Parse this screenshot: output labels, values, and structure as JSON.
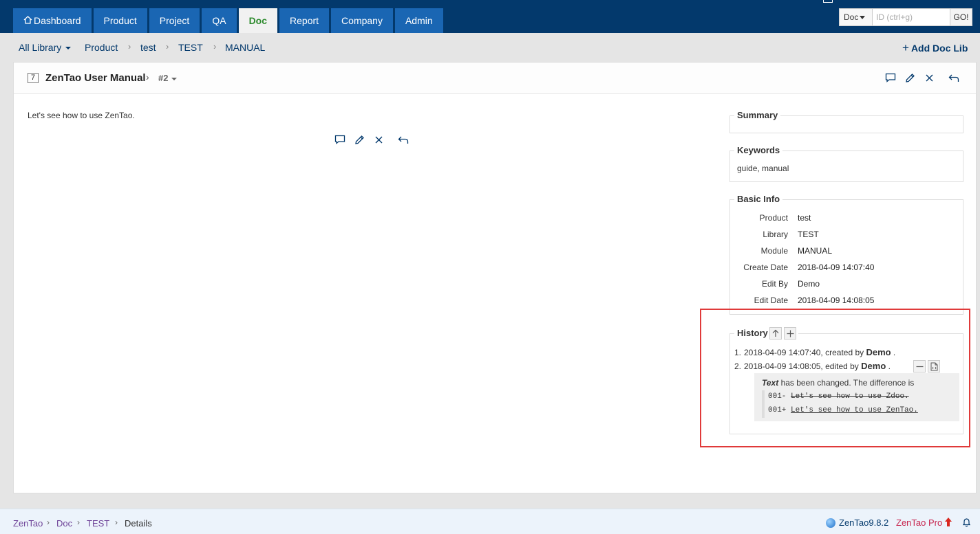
{
  "nav": {
    "tabs": [
      {
        "label": "Dashboard",
        "active": false
      },
      {
        "label": "Product",
        "active": false
      },
      {
        "label": "Project",
        "active": false
      },
      {
        "label": "QA",
        "active": false
      },
      {
        "label": "Doc",
        "active": true
      },
      {
        "label": "Report",
        "active": false
      },
      {
        "label": "Company",
        "active": false
      },
      {
        "label": "Admin",
        "active": false
      }
    ]
  },
  "search": {
    "type": "Doc",
    "placeholder": "ID (ctrl+g)",
    "go_label": "GO!"
  },
  "subnav": {
    "library": "All Library",
    "crumbs": [
      "Product",
      "test",
      "TEST",
      "MANUAL"
    ],
    "add_label": "Add Doc Lib"
  },
  "doc": {
    "id": "7",
    "title": "ZenTao User Manual",
    "version": "#2",
    "content": "Let's see how to use ZenTao."
  },
  "sidebar": {
    "summary_legend": "Summary",
    "keywords_legend": "Keywords",
    "keywords": "guide, manual",
    "basic_legend": "Basic Info",
    "basic": {
      "product_label": "Product",
      "product": "test",
      "library_label": "Library",
      "library": "TEST",
      "module_label": "Module",
      "module": "MANUAL",
      "create_date_label": "Create Date",
      "create_date": "2018-04-09 14:07:40",
      "edit_by_label": "Edit By",
      "edit_by": "Demo",
      "edit_date_label": "Edit Date",
      "edit_date": "2018-04-09 14:08:05"
    },
    "history_legend": "History",
    "history": [
      {
        "num": "1.",
        "text": "2018-04-09 14:07:40, created by ",
        "user": "Demo",
        "tail": " ."
      },
      {
        "num": "2.",
        "text": "2018-04-09 14:08:05, edited by ",
        "user": "Demo",
        "tail": " ."
      }
    ],
    "diff": {
      "field": "Text",
      "message": " has been changed. The difference is",
      "del_prefix": "001- ",
      "del_text": "Let's see how to use Zdoo.",
      "ins_prefix": "001+ ",
      "ins_text": "Let's see how to use ZenTao."
    }
  },
  "footer": {
    "crumbs": [
      "ZenTao",
      "Doc",
      "TEST",
      "Details"
    ],
    "version": "ZenTao9.8.2",
    "pro": "ZenTao Pro"
  },
  "colors": {
    "topbar": "#03396c",
    "tab": "#1a66b3",
    "active_tab_text": "#2e8b2e",
    "highlight": "#e03a3a"
  },
  "icons": [
    "home-icon",
    "comment-icon",
    "edit-icon",
    "close-icon",
    "back-icon",
    "arrow-up-icon",
    "plus-icon",
    "minus-icon",
    "code-file-icon",
    "globe-icon",
    "bell-icon",
    "user-icon"
  ]
}
